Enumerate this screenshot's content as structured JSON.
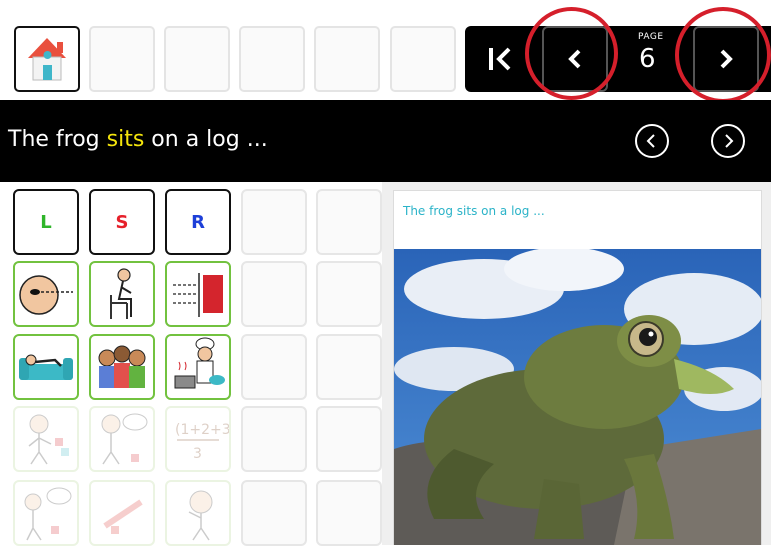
{
  "toolbar": {
    "home_icon": "house-icon",
    "first_page_icon": "first-page-icon",
    "prev_icon": "chevron-left-icon",
    "next_icon": "chevron-right-icon",
    "page_label": "PAGE",
    "page_number": "6"
  },
  "sentence": {
    "before": "The frog ",
    "highlight": "sits",
    "after": " on a log ...",
    "prev_icon": "circle-chevron-left-icon",
    "next_icon": "circle-chevron-right-icon"
  },
  "grid": {
    "letters": [
      {
        "label": "L",
        "color": "#2fb52a"
      },
      {
        "label": "S",
        "color": "#e6202a"
      },
      {
        "label": "R",
        "color": "#1d3fd8"
      }
    ],
    "symbols_row2": [
      "look-symbol",
      "sit-symbol",
      "forward-symbol"
    ],
    "symbols_row3": [
      "relax-symbol",
      "friends-symbol",
      "cook-symbol"
    ],
    "symbols_row4": [
      "feel-symbol",
      "think-symbol",
      "add-symbol"
    ],
    "symbols_row5": [
      "talk-symbol",
      "fall-symbol",
      "wonder-symbol"
    ]
  },
  "panel": {
    "caption": "The frog sits on a log ...",
    "image_icon": "frog-on-log-photo"
  },
  "colors": {
    "accent_red": "#d51f2b",
    "highlight_yellow": "#f4e50c",
    "caption_teal": "#2bb3c8",
    "cell_green": "#72c23f"
  }
}
